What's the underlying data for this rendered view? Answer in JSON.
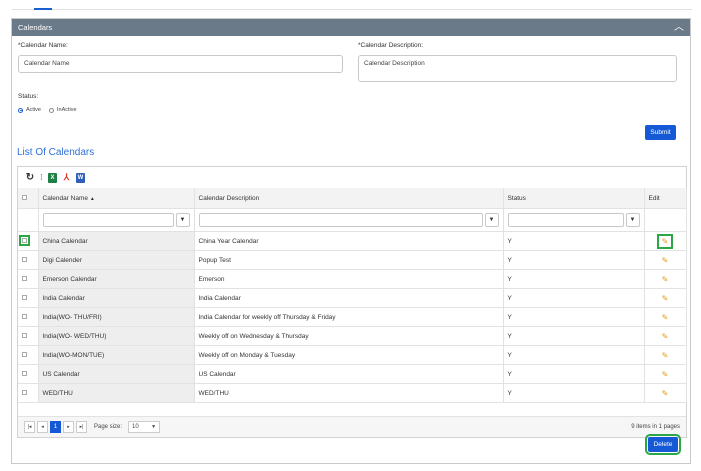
{
  "panel": {
    "title": "Calendars",
    "collapse_icon": "chevron-up-icon"
  },
  "form": {
    "calendar_name_label": "*Calendar Name:",
    "calendar_name_value": "Calendar Name",
    "calendar_description_label": "*Calendar Description:",
    "calendar_description_value": "Calendar Description",
    "status_label": "Status:",
    "status_options": [
      {
        "label": "Active",
        "selected": true
      },
      {
        "label": "InActive",
        "selected": false
      }
    ],
    "submit_label": "Submit"
  },
  "list_title": "List Of Calendars",
  "toolbar": {
    "refresh_icon": "refresh-icon",
    "excel_icon": "excel-icon",
    "excel_text": "X",
    "pdf_icon": "pdf-icon",
    "word_icon": "word-icon",
    "word_text": "W"
  },
  "grid": {
    "columns": {
      "name": "Calendar Name",
      "description": "Calendar Description",
      "status": "Status",
      "edit": "Edit"
    },
    "filter_icon": "filter-icon",
    "rows": [
      {
        "name": "China Calendar",
        "description": "China Year Calendar",
        "status": "Y"
      },
      {
        "name": "Digi Calender",
        "description": "Popup Test",
        "status": "Y"
      },
      {
        "name": "Emerson Calendar",
        "description": "Emerson",
        "status": "Y"
      },
      {
        "name": "India Calendar",
        "description": "India Calendar",
        "status": "Y"
      },
      {
        "name": "India(WO- THU/FRI)",
        "description": "India Calendar for weekly off Thursday & Friday",
        "status": "Y"
      },
      {
        "name": "India(WO- WED/THU)",
        "description": "Weekly off on Wednesday & Thursday",
        "status": "Y"
      },
      {
        "name": "India(WO-MON/TUE)",
        "description": "Weekly off on Monday & Tuesday",
        "status": "Y"
      },
      {
        "name": "US Calendar",
        "description": "US Calendar",
        "status": "Y"
      },
      {
        "name": "WED/THU",
        "description": "WED/THU",
        "status": "Y"
      }
    ]
  },
  "pager": {
    "current_page": "1",
    "page_size_label": "Page size:",
    "page_size_value": "10",
    "info": "9 items in 1 pages"
  },
  "delete_label": "Delete",
  "colors": {
    "header_bg": "#6b7a89",
    "accent_blue": "#1559d6",
    "highlight_green": "#2aa845",
    "pencil_orange": "#e09a1a"
  }
}
